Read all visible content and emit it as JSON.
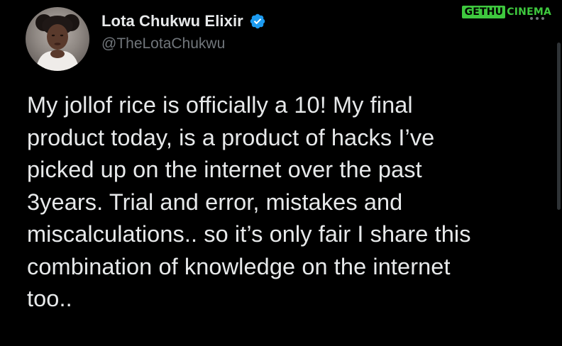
{
  "tweet": {
    "author": {
      "display_name": "Lota Chukwu Elixir",
      "handle": "@TheLotaChukwu",
      "verified": true
    },
    "text_lines": [
      "My jollof rice is officially a 10! My final",
      "product today, is a product of hacks I’ve",
      "picked up on the internet over the past",
      "3years. Trial and error, mistakes and",
      "miscalculations.. so it’s only fair I share this",
      "combination of knowledge on the internet",
      "too.."
    ]
  },
  "watermark": {
    "box_text": "GETHU",
    "text": "CINEMA"
  },
  "icons": {
    "verified": "verified-badge-icon",
    "more": "more-options-icon"
  },
  "colors": {
    "background": "#000000",
    "text_primary": "#e7e9ea",
    "text_secondary": "#71767b",
    "verified_blue": "#1d9bf0",
    "watermark_green": "#3ec83e"
  }
}
